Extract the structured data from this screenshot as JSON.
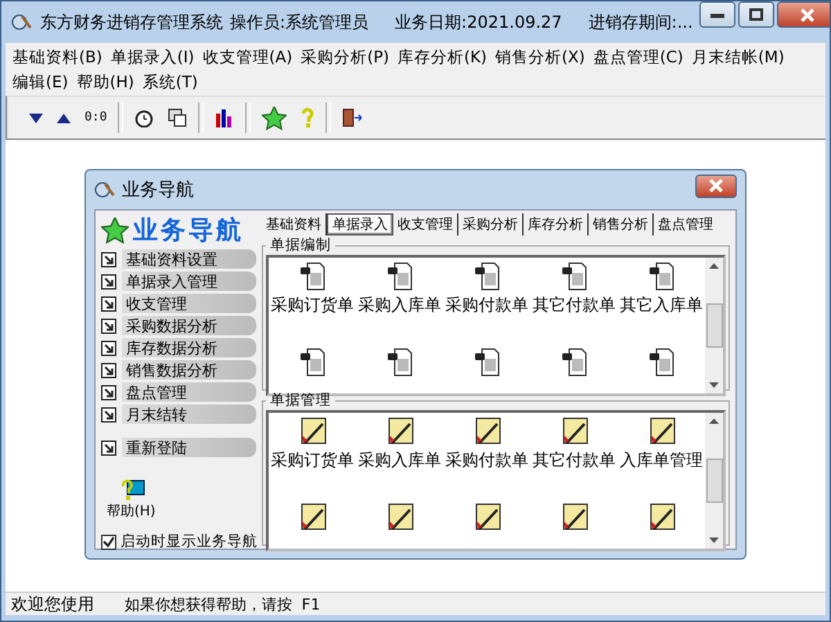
{
  "window": {
    "title": "东方财务进销存管理系统",
    "operator": "操作员:系统管理员",
    "date": "业务日期:2021.09.27",
    "period": "进销存期间:..."
  },
  "menu": [
    {
      "label": "基础资料(B)"
    },
    {
      "label": "单据录入(I)"
    },
    {
      "label": "收支管理(A)"
    },
    {
      "label": "采购分析(P)"
    },
    {
      "label": "库存分析(K)"
    },
    {
      "label": "销售分析(X)"
    },
    {
      "label": "盘点管理(C)"
    },
    {
      "label": "月末结帐(M)"
    },
    {
      "label": "编辑(E)"
    },
    {
      "label": "帮助(H)"
    },
    {
      "label": "系统(T)"
    }
  ],
  "toolbar": [
    {
      "kind": "down"
    },
    {
      "kind": "up"
    },
    {
      "kind": "text",
      "label": "0:0"
    },
    {
      "kind": "sep"
    },
    {
      "kind": "clock"
    },
    {
      "kind": "window"
    },
    {
      "kind": "sep"
    },
    {
      "kind": "chart"
    },
    {
      "kind": "sep"
    },
    {
      "kind": "star"
    },
    {
      "kind": "help"
    },
    {
      "kind": "sep"
    },
    {
      "kind": "exit"
    }
  ],
  "dialog": {
    "title": "业务导航",
    "heading": "业务导航",
    "nav_items": [
      {
        "label": "基础资料设置"
      },
      {
        "label": "单据录入管理"
      },
      {
        "label": "收支管理"
      },
      {
        "label": "采购数据分析"
      },
      {
        "label": "库存数据分析"
      },
      {
        "label": "销售数据分析"
      },
      {
        "label": "盘点管理"
      },
      {
        "label": "月末结转"
      }
    ],
    "relogin": "重新登陆",
    "help": "帮助(H)",
    "show_on_start": {
      "label": "启动时显示业务导航",
      "checked": true
    },
    "tabs": [
      {
        "label": "基础资料",
        "selected": false
      },
      {
        "label": "单据录入",
        "selected": true
      },
      {
        "label": "收支管理",
        "selected": false
      },
      {
        "label": "采购分析",
        "selected": false
      },
      {
        "label": "库存分析",
        "selected": false
      },
      {
        "label": "销售分析",
        "selected": false
      },
      {
        "label": "盘点管理",
        "selected": false
      }
    ],
    "groups": [
      {
        "title": "单据编制",
        "kind": "doc",
        "items": [
          "采购订货单",
          "采购入库单",
          "采购付款单",
          "其它付款单",
          "其它入库单"
        ]
      },
      {
        "title": "单据管理",
        "kind": "manage",
        "items": [
          "采购订货单",
          "采购入库单",
          "采购付款单",
          "其它付款单",
          "入库单管理"
        ]
      }
    ]
  },
  "status_bar": {
    "left": "欢迎您使用",
    "message": "如果你想获得帮助，请按 F1"
  }
}
